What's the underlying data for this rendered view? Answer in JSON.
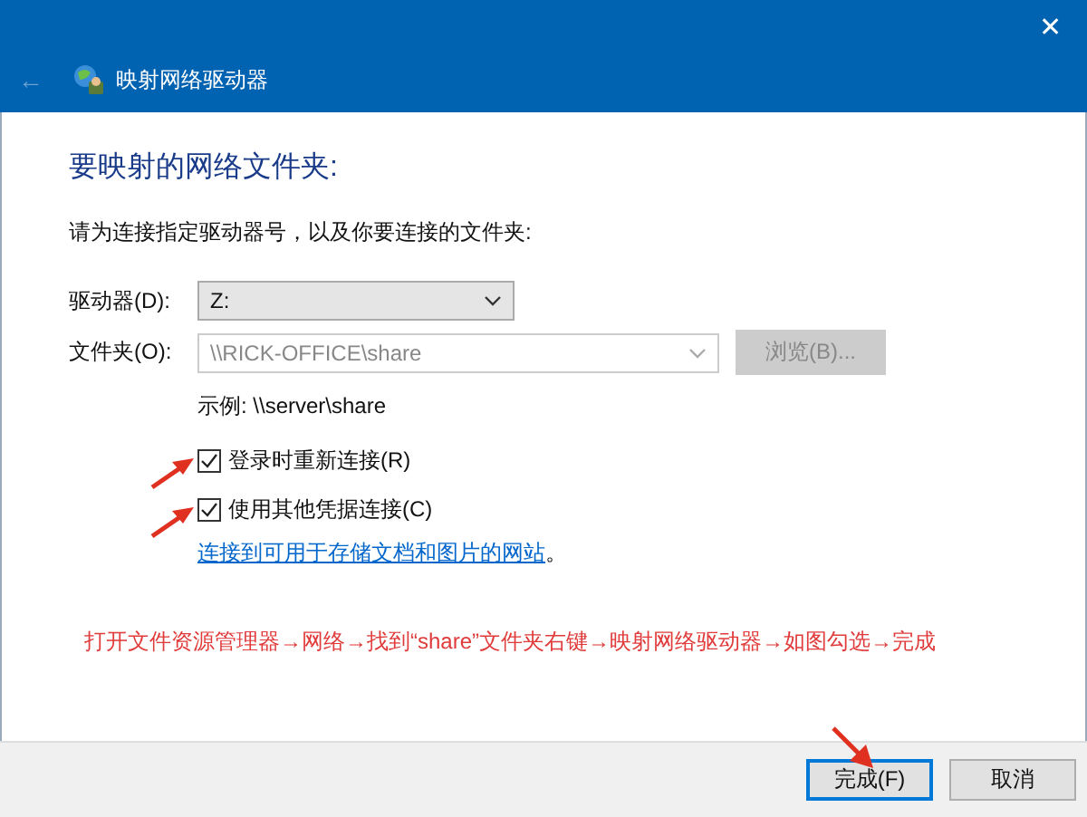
{
  "window": {
    "title": "映射网络驱动器",
    "close": "✕",
    "back": "←"
  },
  "heading": "要映射的网络文件夹:",
  "instruction": "请为连接指定驱动器号，以及你要连接的文件夹:",
  "drive": {
    "label": "驱动器(D):",
    "value": "Z:",
    "disabled": false
  },
  "folder": {
    "label": "文件夹(O):",
    "value": "\\\\RICK-OFFICE\\share",
    "disabled": true
  },
  "browse_button": {
    "label": "浏览(B)...",
    "disabled": true
  },
  "example": "示例: \\\\server\\share",
  "checkboxes": [
    {
      "label": "登录时重新连接(R)",
      "checked": true
    },
    {
      "label": "使用其他凭据连接(C)",
      "checked": true
    }
  ],
  "link": "连接到可用于存储文档和图片的网站",
  "link_suffix": "。",
  "annotation": "打开文件资源管理器→网络→找到“share”文件夹右键→映射网络驱动器→如图勾选→完成",
  "buttons": [
    {
      "label": "完成(F)",
      "kind": "default"
    },
    {
      "label": "取消",
      "kind": "normal"
    }
  ]
}
